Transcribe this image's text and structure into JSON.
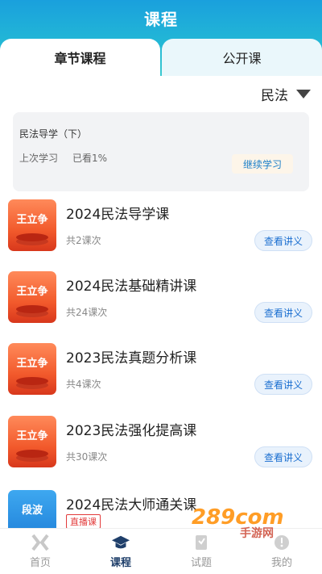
{
  "header": {
    "title": "课程"
  },
  "tabs": [
    {
      "label": "章节课程",
      "active": true
    },
    {
      "label": "公开课",
      "active": false
    }
  ],
  "filter": {
    "selected": "民法"
  },
  "progress_card": {
    "title": "民法导学（下）",
    "last_label": "上次学习",
    "seen_label": "已看1%",
    "continue_label": "继续学习"
  },
  "courses": [
    {
      "teacher": "王立争",
      "title": "2024民法导学课",
      "count": "共2课次",
      "action": "查看讲义"
    },
    {
      "teacher": "王立争",
      "title": "2024民法基础精讲课",
      "count": "共24课次",
      "action": "查看讲义"
    },
    {
      "teacher": "王立争",
      "title": "2023民法真题分析课",
      "count": "共4课次",
      "action": "查看讲义"
    },
    {
      "teacher": "王立争",
      "title": "2023民法强化提高课",
      "count": "共30课次",
      "action": "查看讲义"
    },
    {
      "teacher": "段波",
      "title": "2024民法大师通关课",
      "badge": "直播课"
    }
  ],
  "bottom_nav": [
    {
      "label": "首页",
      "icon": "home-x-icon",
      "active": false
    },
    {
      "label": "课程",
      "icon": "graduation-cap-icon",
      "active": true
    },
    {
      "label": "试题",
      "icon": "exam-icon",
      "active": false
    },
    {
      "label": "我的",
      "icon": "profile-icon",
      "active": false
    }
  ],
  "watermark": {
    "text": "289com",
    "subtext": "手游网"
  },
  "colors": {
    "header_gradient_start": "#1aa0dd",
    "header_gradient_end": "#3bc9cf",
    "accent_blue": "#1b6fd0",
    "live_badge": "#e23b3b"
  }
}
